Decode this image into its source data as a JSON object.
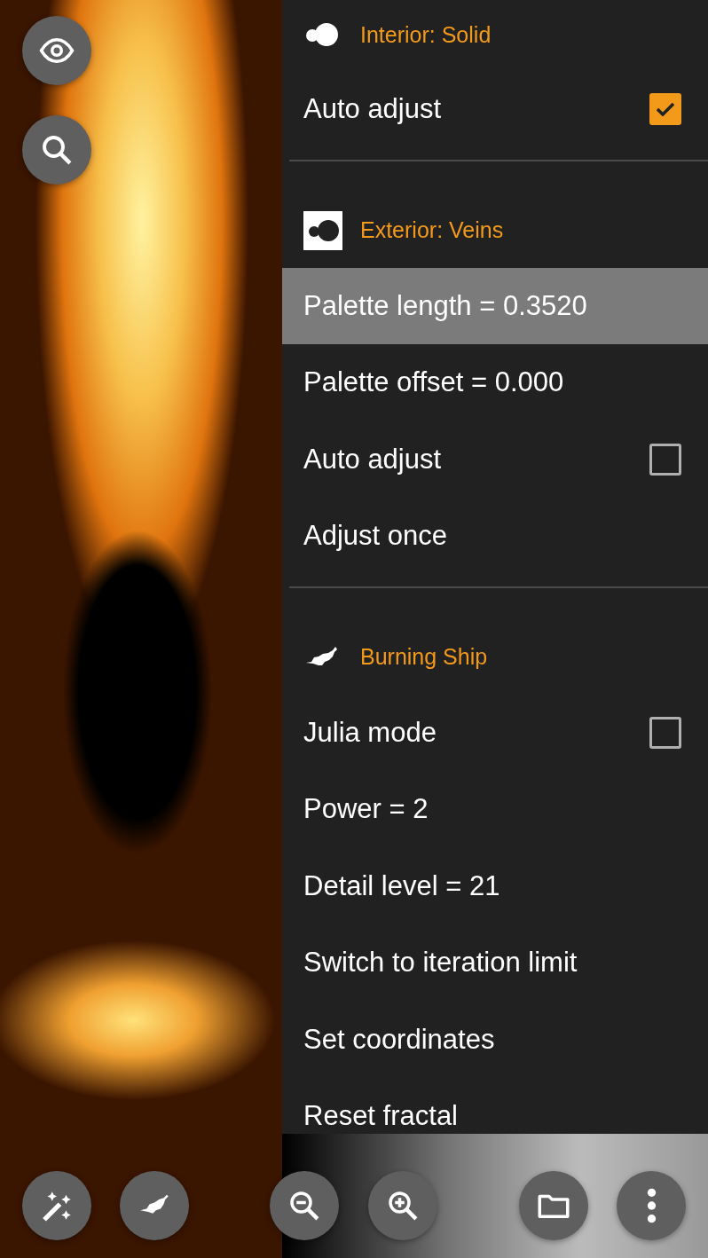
{
  "menu": [
    {
      "kind": "header",
      "label": "Interior: Solid"
    },
    {
      "kind": "checkbox",
      "label": "Auto adjust",
      "checked": true
    },
    {
      "kind": "divider"
    },
    {
      "kind": "header",
      "label": "Exterior: Veins"
    },
    {
      "kind": "item",
      "label": "Palette length = 0.3520",
      "selected": true
    },
    {
      "kind": "item",
      "label": "Palette offset = 0.000",
      "selected": false
    },
    {
      "kind": "checkbox",
      "label": "Auto adjust",
      "checked": false
    },
    {
      "kind": "item",
      "label": "Adjust once",
      "selected": false
    },
    {
      "kind": "divider"
    },
    {
      "kind": "header",
      "label": "Burning Ship"
    },
    {
      "kind": "checkbox",
      "label": "Julia mode",
      "checked": false
    },
    {
      "kind": "item",
      "label": "Power = 2",
      "selected": false
    },
    {
      "kind": "item",
      "label": "Detail level = 21",
      "selected": false
    },
    {
      "kind": "item",
      "label": "Switch to iteration limit",
      "selected": false
    },
    {
      "kind": "item",
      "label": "Set coordinates",
      "selected": false
    },
    {
      "kind": "item",
      "label": "Reset fractal",
      "selected": false
    }
  ]
}
